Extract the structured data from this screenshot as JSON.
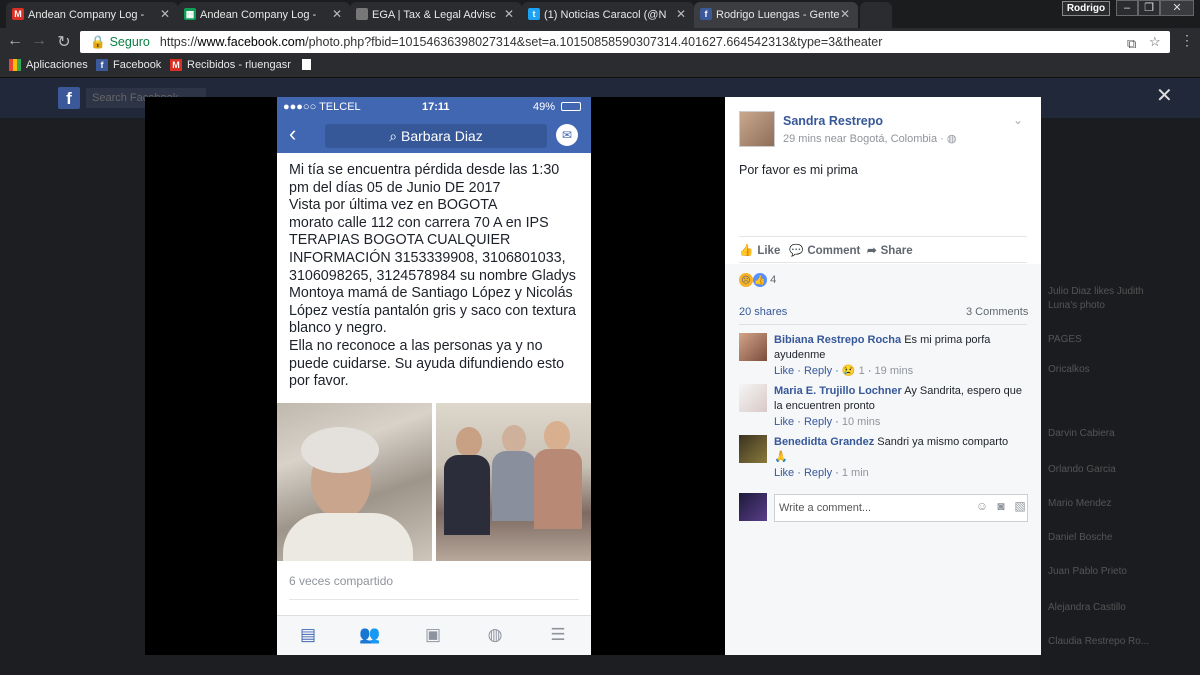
{
  "browser": {
    "tabs": [
      {
        "title": "Andean Company Log -",
        "favicon": "gmail-icon",
        "color": "#d93025"
      },
      {
        "title": "Andean Company Log -",
        "favicon": "sheets-icon",
        "color": "#0f9d58"
      },
      {
        "title": "EGA | Tax & Legal Advisc",
        "favicon": "page-icon",
        "color": "#888888"
      },
      {
        "title": "(1) Noticias Caracol (@N",
        "favicon": "twitter-icon",
        "color": "#1da1f2"
      },
      {
        "title": "Rodrigo Luengas - Gente",
        "favicon": "facebook-icon",
        "color": "#3b5998"
      }
    ],
    "profile": "Rodrigo",
    "secure_label": "Seguro",
    "url_prefix": "https://",
    "url_host": "www.facebook.com",
    "url_path": "/photo.php?fbid=10154636398027314&set=a.10150858590307314.401627.664542313&type=3&theater",
    "bookmarks": [
      {
        "label": "Aplicaciones",
        "icon": "apps-icon"
      },
      {
        "label": "Facebook",
        "icon": "facebook-icon"
      },
      {
        "label": "Recibidos - rluengasr",
        "icon": "gmail-icon"
      }
    ]
  },
  "facebook": {
    "search_placeholder": "Search Facebook",
    "sidebar_bg": [
      "Julio Diaz likes Judith",
      "Luna's photo",
      "PAGES",
      "Oricalkos",
      "Darvin Cabiera",
      "Orlando Garcia",
      "Mario Mendez",
      "Daniel Bosche",
      "Juan Pablo Prieto",
      "Alejandra Castillo",
      "Claudia Restrepo Ro..."
    ]
  },
  "phone": {
    "carrier": "●●●○○ TELCEL",
    "time": "17:11",
    "battery": "49%",
    "search_title": "Barbara Diaz",
    "post_lines": [
      "Mi tía se encuentra pérdida desde las 1:30",
      "pm del días 05 de Junio DE 2017",
      "Vista por última vez en BOGOTA",
      "morato calle 112 con carrera 70 A en IPS",
      "TERAPIAS BOGOTA CUALQUIER",
      "INFORMACIÓN 3153339908, 3106801033,",
      "3106098265, 3124578984 su nombre Gladys",
      "Montoya mamá de Santiago López y Nicolás",
      "López vestía pantalón gris y saco con textura",
      "blanco y negro.",
      "Ella no reconoce a las personas ya y no",
      "puede cuidarse. Su ayuda difundiendo esto",
      "por favor."
    ],
    "shared_text": "6 veces compartido"
  },
  "post": {
    "author": "Sandra Restrepo",
    "meta": "29 mins near Bogotá, Colombia · ",
    "text": "Por favor es mi prima",
    "like_label": "Like",
    "comment_label": "Comment",
    "share_label": "Share",
    "reaction_count": "4",
    "shares": "20 shares",
    "comments_count": "3 Comments",
    "write_placeholder": "Write a comment..."
  },
  "comments": [
    {
      "name": "Bibiana Restrepo Rocha",
      "text": " Es mi prima porfa ayudenme",
      "like": "Like",
      "reply": "Reply",
      "reactions": "1",
      "time": "19 mins"
    },
    {
      "name": "Maria E. Trujillo Lochner",
      "text": " Ay Sandrita, espero que la encuentren pronto",
      "like": "Like",
      "reply": "Reply",
      "time": "10 mins"
    },
    {
      "name": "Benedidta Grandez",
      "text": " Sandri ya mismo comparto",
      "emoji": "🙏",
      "like": "Like",
      "reply": "Reply",
      "time": "1 min"
    }
  ]
}
